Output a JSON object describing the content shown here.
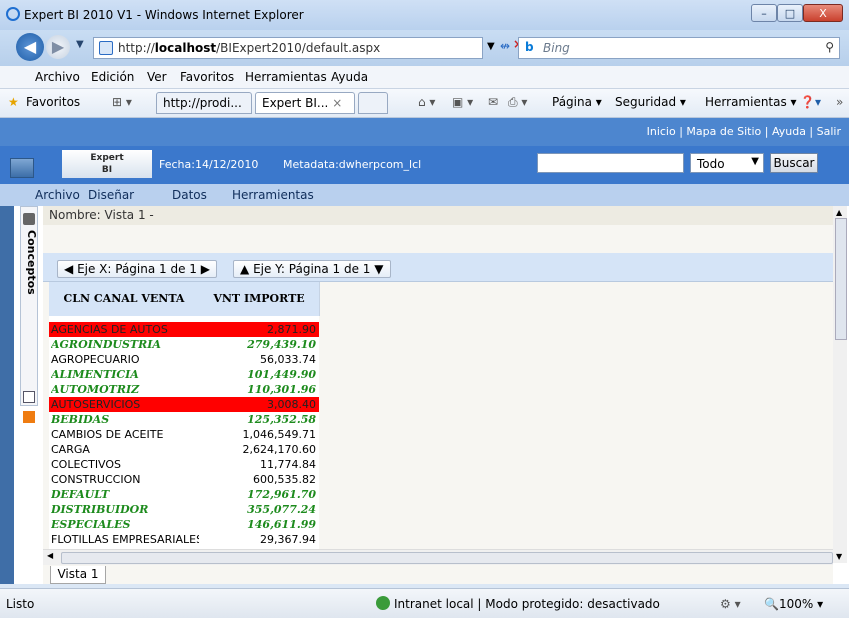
{
  "window": {
    "title": "Expert BI 2010 V1 - Windows Internet Explorer",
    "minimize": "–",
    "maximize": "□",
    "close": "X"
  },
  "browser": {
    "url_prefix": "http://",
    "url_host": "localhost",
    "url_path": "/BIExpert2010/default.aspx",
    "search_engine": "Bing",
    "search_placeholder": "Bing",
    "menu": [
      "Archivo",
      "Edición",
      "Ver",
      "Favoritos",
      "Herramientas",
      "Ayuda"
    ],
    "favorites_label": "Favoritos",
    "tabs": [
      "http://prodi...",
      "Expert BI..."
    ],
    "toolbar": [
      "Página ▾",
      "Seguridad ▾",
      "Herramientas ▾"
    ]
  },
  "app": {
    "top_links": "Inicio  |  Mapa de Sitio  |  Ayuda  |  Salir",
    "brand_line1": "Expert",
    "brand_line2": "BI",
    "fecha": "Fecha:14/12/2010",
    "metadata": "Metadata:dwherpcom_lcl",
    "search_scope": "Todo",
    "search_button": "Buscar",
    "menu": [
      "Archivo",
      "Diseñar",
      "Datos",
      "Herramientas"
    ],
    "conceptos_label": "Conceptos",
    "view_title": "Nombre: Vista 1 -",
    "axis_x": "Eje X: Página 1 de 1",
    "axis_y": "Eje Y: Página 1 de 1",
    "tab_label": "Vista 1"
  },
  "grid": {
    "headers": [
      "CLN CANAL VENTA",
      "VNT IMPORTE VENTA"
    ],
    "rows": [
      {
        "name": "AGENCIAS DE AUTOS",
        "value": "2,871.90",
        "style": "red"
      },
      {
        "name": "AGROINDUSTRIA",
        "value": "279,439.10",
        "style": "green"
      },
      {
        "name": "AGROPECUARIO",
        "value": "56,033.74",
        "style": "normal"
      },
      {
        "name": "ALIMENTICIA",
        "value": "101,449.90",
        "style": "green"
      },
      {
        "name": "AUTOMOTRIZ",
        "value": "110,301.96",
        "style": "green"
      },
      {
        "name": "AUTOSERVICIOS",
        "value": "3,008.40",
        "style": "red"
      },
      {
        "name": "BEBIDAS",
        "value": "125,352.58",
        "style": "green"
      },
      {
        "name": "CAMBIOS DE ACEITE",
        "value": "1,046,549.71",
        "style": "normal"
      },
      {
        "name": "CARGA",
        "value": "2,624,170.60",
        "style": "normal"
      },
      {
        "name": "COLECTIVOS",
        "value": "11,774.84",
        "style": "normal"
      },
      {
        "name": "CONSTRUCCION",
        "value": "600,535.82",
        "style": "normal"
      },
      {
        "name": "DEFAULT",
        "value": "172,961.70",
        "style": "green"
      },
      {
        "name": "DISTRIBUIDOR",
        "value": "355,077.24",
        "style": "green"
      },
      {
        "name": "ESPECIALES",
        "value": "146,611.99",
        "style": "green"
      },
      {
        "name": "FLOTILLAS EMPRESARIALES",
        "value": "29,367.94",
        "style": "normal"
      }
    ]
  },
  "statusbar": {
    "left": "Listo",
    "zone": "Intranet local | Modo protegido: desactivado",
    "zoom": "100%"
  },
  "colors": {
    "header_blue": "#3b78cc",
    "red_highlight": "#ff0000",
    "green_text": "#1d8b1d"
  }
}
